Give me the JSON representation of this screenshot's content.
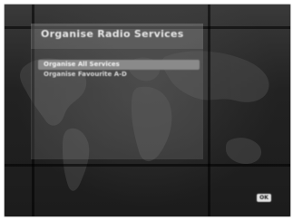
{
  "screen": {
    "title": "Organise Radio Services",
    "menu": {
      "items": [
        {
          "label": "Organise All Services",
          "selected": true
        },
        {
          "label": "Organise Favourite A-D",
          "selected": false
        }
      ]
    },
    "ok_button_label": "OK"
  },
  "icons": {
    "ok": "ok-button-icon"
  },
  "colors": {
    "background": "#262626",
    "panel": "#aaaaaa",
    "selected_item": "#8a8a8a",
    "text": "#e6e6e6"
  }
}
